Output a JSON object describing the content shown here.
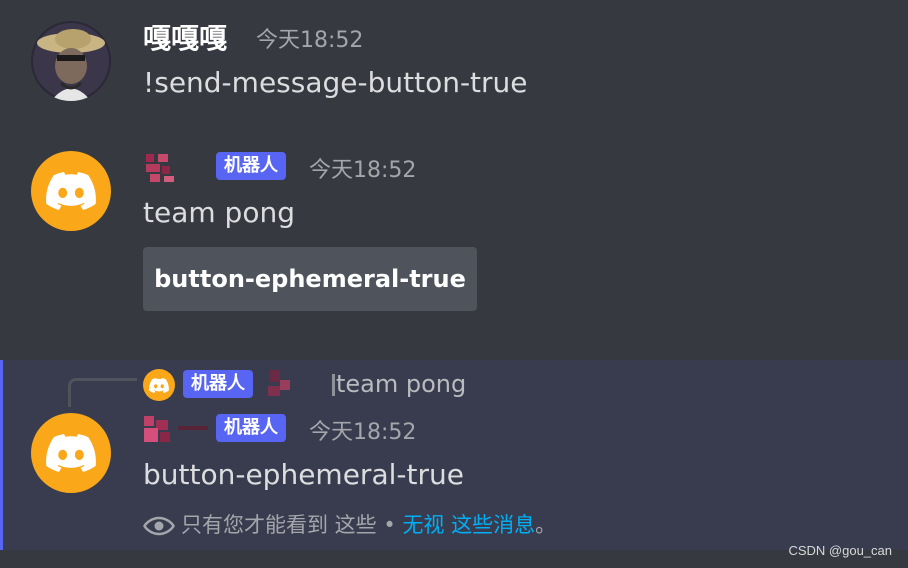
{
  "messages": {
    "first": {
      "username": "嘎嘎嘎",
      "timestamp": "今天18:52",
      "content": "!send-message-button-true"
    },
    "second": {
      "bot_tag": "机器人",
      "timestamp": "今天18:52",
      "content": "team pong",
      "button_label": "button-ephemeral-true"
    },
    "third": {
      "reply_bot_tag": "机器人",
      "reply_content": "team pong",
      "bot_tag": "机器人",
      "timestamp": "今天18:52",
      "content": "button-ephemeral-true",
      "notice_text": "只有您才能看到 这些 •",
      "notice_link": "无视 这些消息",
      "notice_end": "。"
    }
  },
  "watermark": "CSDN @gou_can",
  "colors": {
    "background": "#36393f",
    "highlight": "#393c4f",
    "accent": "#5865f2",
    "bot_avatar": "#faa81a",
    "link": "#00aff4"
  },
  "icons": [
    "discord-logo-icon",
    "eye-icon"
  ]
}
